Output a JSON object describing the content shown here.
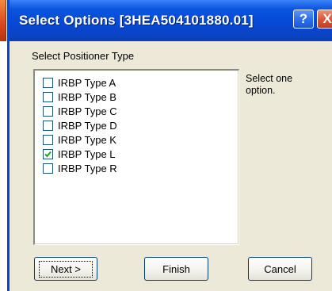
{
  "window": {
    "title": "Select Options [3HEA504101880.01]",
    "help_label": "?",
    "close_label": "X"
  },
  "group_label": "Select Positioner Type",
  "options": [
    {
      "label": "IRBP Type A",
      "checked": false
    },
    {
      "label": "IRBP Type B",
      "checked": false
    },
    {
      "label": "IRBP Type C",
      "checked": false
    },
    {
      "label": "IRBP Type D",
      "checked": false
    },
    {
      "label": "IRBP Type K",
      "checked": false
    },
    {
      "label": "IRBP Type L",
      "checked": true
    },
    {
      "label": "IRBP Type R",
      "checked": false
    }
  ],
  "hint": "Select one option.",
  "buttons": {
    "next": "Next >",
    "finish": "Finish",
    "cancel": "Cancel"
  },
  "colors": {
    "titlebar": "#0649d6",
    "dialog_bg": "#ece9d8",
    "close_button": "#de5637"
  }
}
